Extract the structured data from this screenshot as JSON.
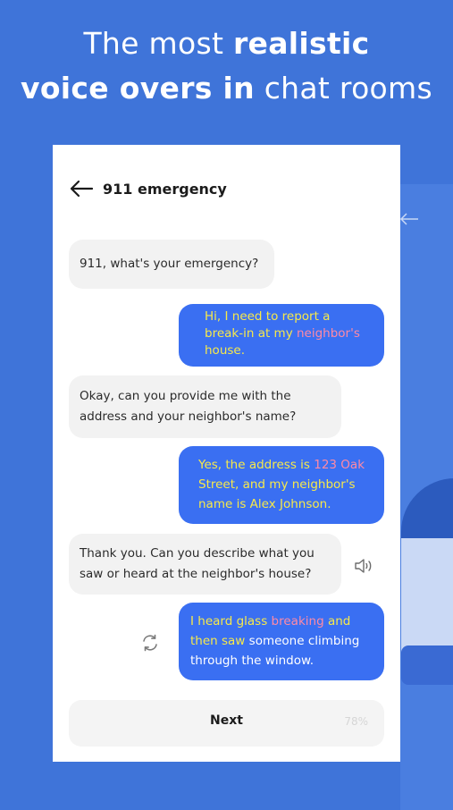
{
  "headline": {
    "line1_light": "The most ",
    "line1_bold": "realistic",
    "line2_bold": "voice overs in",
    "line2_light": " chat rooms"
  },
  "chat": {
    "title": "911 emergency",
    "messages": [
      {
        "side": "in",
        "parts": [
          {
            "text": "911, what's your emergency?"
          }
        ]
      },
      {
        "side": "out",
        "lines": [
          [
            {
              "text": "Hi, I need to report a",
              "color": "yellow"
            }
          ],
          [
            {
              "text": "break-in at my ",
              "color": "yellow"
            },
            {
              "text": "neighbor's",
              "color": "pink"
            }
          ],
          [
            {
              "text": "house.",
              "color": "yellow"
            }
          ]
        ]
      },
      {
        "side": "in",
        "lines": [
          [
            {
              "text": "Okay, can you provide me with the"
            }
          ],
          [
            {
              "text": "address and your neighbor's name?"
            }
          ]
        ]
      },
      {
        "side": "out",
        "lines": [
          [
            {
              "text": "Yes, the address is ",
              "color": "yellow"
            },
            {
              "text": "123 Oak",
              "color": "pink"
            }
          ],
          [
            {
              "text": "Street, and my neighbor's",
              "color": "yellow"
            }
          ],
          [
            {
              "text": "name is Alex Johnson.",
              "color": "yellow"
            }
          ]
        ]
      },
      {
        "side": "in",
        "lines": [
          [
            {
              "text": "Thank you. Can you describe what you"
            }
          ],
          [
            {
              "text": "saw or heard at the neighbor's house?"
            }
          ]
        ]
      },
      {
        "side": "out",
        "lines": [
          [
            {
              "text": "I heard glass ",
              "color": "yellow"
            },
            {
              "text": "breaking",
              "color": "pink"
            },
            {
              "text": " and",
              "color": "yellow"
            }
          ],
          [
            {
              "text": "then saw ",
              "color": "yellow"
            },
            {
              "text": "someone climbing",
              "color": "white"
            }
          ],
          [
            {
              "text": "through the window.",
              "color": "white"
            }
          ]
        ]
      }
    ]
  },
  "icons": {
    "back": "arrow-left-icon",
    "speaker": "speaker-icon",
    "refresh": "refresh-icon"
  },
  "footer": {
    "next_label": "Next",
    "progress_text": "78%",
    "progress": 0.78
  },
  "colors": {
    "background": "#3f74d9",
    "outgoing_bubble": "#3a6ff2",
    "incoming_bubble": "#f2f2f2",
    "highlight_yellow": "#f7e94a",
    "highlight_pink": "#ff8aa5"
  }
}
